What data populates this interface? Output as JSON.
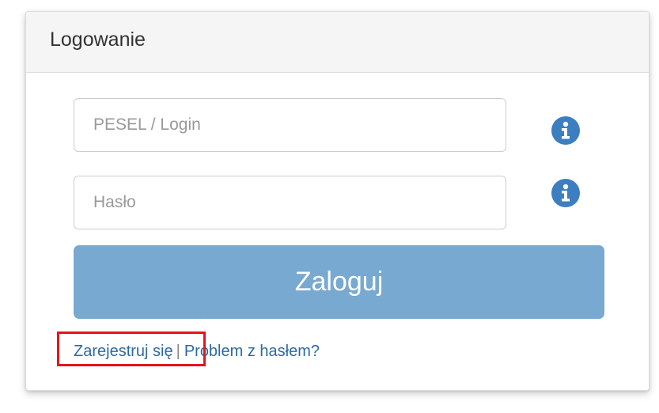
{
  "panel": {
    "title": "Logowanie"
  },
  "form": {
    "login_placeholder": "PESEL / Login",
    "login_value": "",
    "password_placeholder": "Hasło",
    "password_value": "",
    "submit_label": "Zaloguj"
  },
  "links": {
    "register": "Zarejestruj się",
    "separator": "|",
    "password_problem": "Problem z hasłem?"
  },
  "icons": {
    "info": "info-circle-icon"
  },
  "colors": {
    "accent": "#78a9d0",
    "link": "#2c6aa4",
    "info_icon": "#3c7ebf",
    "highlight": "#e5141b"
  }
}
